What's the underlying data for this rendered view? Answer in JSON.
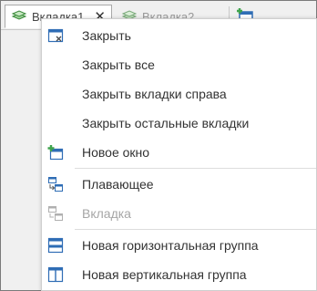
{
  "tabs": [
    {
      "label": "Вкладка1",
      "active": true
    },
    {
      "label": "Вкладка2",
      "active": false
    }
  ],
  "menu": {
    "items": [
      {
        "label": "Закрыть",
        "icon": "close-window-icon",
        "enabled": true
      },
      {
        "label": "Закрыть все",
        "icon": "",
        "enabled": true
      },
      {
        "label": "Закрыть вкладки справа",
        "icon": "",
        "enabled": true
      },
      {
        "label": "Закрыть остальные вкладки",
        "icon": "",
        "enabled": true
      },
      {
        "label": "Новое окно",
        "icon": "new-window-icon",
        "enabled": true
      },
      {
        "label": "Плавающее",
        "icon": "floating-icon",
        "enabled": true
      },
      {
        "label": "Вкладка",
        "icon": "docked-tab-icon",
        "enabled": false
      },
      {
        "label": "Новая горизонтальная группа",
        "icon": "horizontal-group-icon",
        "enabled": true
      },
      {
        "label": "Новая вертикальная группа",
        "icon": "vertical-group-icon",
        "enabled": true
      }
    ]
  },
  "colors": {
    "accent_blue": "#2f6db5",
    "accent_green": "#3fa34d",
    "disabled_text": "#a6a6a6"
  }
}
